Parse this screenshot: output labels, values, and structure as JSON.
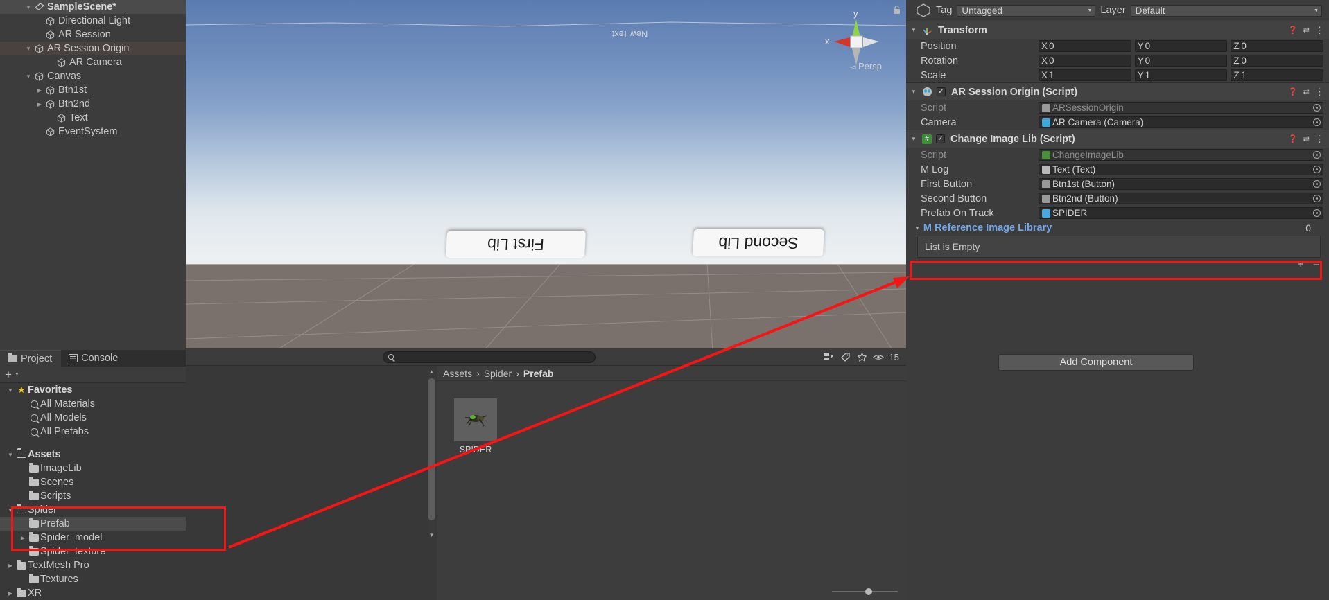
{
  "hierarchy": {
    "items": [
      {
        "label": "SampleScene*",
        "icon": "scene-icon",
        "depth": 2,
        "twisty": "down",
        "selected": false,
        "bold": true,
        "header": true
      },
      {
        "label": "Directional Light",
        "icon": "cube-icon",
        "depth": 3,
        "twisty": "",
        "selected": false
      },
      {
        "label": "AR Session",
        "icon": "cube-icon",
        "depth": 3,
        "twisty": "",
        "selected": false
      },
      {
        "label": "AR Session Origin",
        "icon": "cube-icon",
        "depth": 2,
        "twisty": "down",
        "selected": true
      },
      {
        "label": "AR Camera",
        "icon": "cube-icon",
        "depth": 4,
        "twisty": "",
        "selected": false
      },
      {
        "label": "Canvas",
        "icon": "cube-icon",
        "depth": 2,
        "twisty": "down",
        "selected": false
      },
      {
        "label": "Btn1st",
        "icon": "cube-icon",
        "depth": 3,
        "twisty": "right",
        "selected": false
      },
      {
        "label": "Btn2nd",
        "icon": "cube-icon",
        "depth": 3,
        "twisty": "right",
        "selected": false
      },
      {
        "label": "Text",
        "icon": "cube-icon",
        "depth": 4,
        "twisty": "",
        "selected": false
      },
      {
        "label": "EventSystem",
        "icon": "cube-icon",
        "depth": 3,
        "twisty": "",
        "selected": false
      }
    ]
  },
  "scene": {
    "new_text_label": "New Text",
    "plane_first": "First Lib",
    "plane_second": "Second Lib",
    "persp_label": "Persp",
    "gizmo_axis_y": "y",
    "gizmo_axis_x": "x"
  },
  "project": {
    "tabs": [
      {
        "label": "Project",
        "icon": "folder-icon",
        "active": true
      },
      {
        "label": "Console",
        "icon": "console-icon",
        "active": false
      }
    ],
    "tree": [
      {
        "label": "Favorites",
        "icon": "star-icon",
        "depth": 0,
        "twisty": "down",
        "bold": true,
        "selected": false
      },
      {
        "label": "All Materials",
        "icon": "search-icon",
        "depth": 1,
        "twisty": "",
        "bold": false,
        "selected": false
      },
      {
        "label": "All Models",
        "icon": "search-icon",
        "depth": 1,
        "twisty": "",
        "bold": false,
        "selected": false
      },
      {
        "label": "All Prefabs",
        "icon": "search-icon",
        "depth": 1,
        "twisty": "",
        "bold": false,
        "selected": false
      },
      {
        "label": "",
        "icon": "",
        "depth": 0,
        "twisty": "",
        "bold": false,
        "selected": false,
        "spacer": true
      },
      {
        "label": "Assets",
        "icon": "folder-open-icon",
        "depth": 0,
        "twisty": "down",
        "bold": true,
        "selected": false
      },
      {
        "label": "ImageLib",
        "icon": "folder-icon",
        "depth": 1,
        "twisty": "",
        "bold": false,
        "selected": false
      },
      {
        "label": "Scenes",
        "icon": "folder-icon",
        "depth": 1,
        "twisty": "",
        "bold": false,
        "selected": false
      },
      {
        "label": "Scripts",
        "icon": "folder-icon",
        "depth": 1,
        "twisty": "",
        "bold": false,
        "selected": false
      },
      {
        "label": "Spider",
        "icon": "folder-open-icon",
        "depth": 0,
        "twisty": "down",
        "bold": false,
        "selected": false
      },
      {
        "label": "Prefab",
        "icon": "folder-icon",
        "depth": 1,
        "twisty": "",
        "bold": false,
        "selected": true
      },
      {
        "label": "Spider_model",
        "icon": "folder-icon",
        "depth": 1,
        "twisty": "right",
        "bold": false,
        "selected": false
      },
      {
        "label": "Spider_texture",
        "icon": "folder-icon",
        "depth": 1,
        "twisty": "",
        "bold": false,
        "selected": false
      },
      {
        "label": "TextMesh Pro",
        "icon": "folder-icon",
        "depth": 0,
        "twisty": "right",
        "bold": false,
        "selected": false
      },
      {
        "label": "Textures",
        "icon": "folder-icon",
        "depth": 1,
        "twisty": "",
        "bold": false,
        "selected": false
      },
      {
        "label": "XR",
        "icon": "folder-icon",
        "depth": 0,
        "twisty": "right",
        "bold": false,
        "selected": false
      }
    ],
    "search_placeholder": "",
    "search_value": "",
    "item_count": "15",
    "breadcrumb": [
      "Assets",
      "Spider",
      "Prefab"
    ],
    "breadcrumb_separator": "›",
    "assets": [
      {
        "name": "SPIDER",
        "icon": "spider-prefab-thumbnail"
      }
    ]
  },
  "inspector": {
    "tag_label": "Tag",
    "tag_value": "Untagged",
    "layer_label": "Layer",
    "layer_value": "Default",
    "components": [
      {
        "title": "Transform",
        "icon": "transform-icon",
        "has_checkbox": false,
        "rows": [
          {
            "label": "Position",
            "type": "vector3",
            "x": "0",
            "y": "0",
            "z": "0"
          },
          {
            "label": "Rotation",
            "type": "vector3",
            "x": "0",
            "y": "0",
            "z": "0"
          },
          {
            "label": "Scale",
            "type": "vector3",
            "x": "1",
            "y": "1",
            "z": "1"
          }
        ]
      },
      {
        "title": "AR Session Origin (Script)",
        "icon": "script-ar-icon",
        "has_checkbox": true,
        "checked": true,
        "rows": [
          {
            "label": "Script",
            "type": "object",
            "value": "ARSessionOrigin",
            "dim": true,
            "icon": "ar-script-icon"
          },
          {
            "label": "Camera",
            "type": "object",
            "value": "AR Camera (Camera)",
            "dim": false,
            "icon": "camera-icon"
          }
        ]
      },
      {
        "title": "Change Image Lib (Script)",
        "icon": "csharp-script-icon",
        "has_checkbox": true,
        "checked": true,
        "rows": [
          {
            "label": "Script",
            "type": "object",
            "value": "ChangeImageLib",
            "dim": true,
            "icon": "csharp-script-icon"
          },
          {
            "label": "M Log",
            "type": "object",
            "value": "Text (Text)",
            "dim": false,
            "icon": "text-icon"
          },
          {
            "label": "First Button",
            "type": "object",
            "value": "Btn1st (Button)",
            "dim": false,
            "icon": "button-icon"
          },
          {
            "label": "Second Button",
            "type": "object",
            "value": "Btn2nd (Button)",
            "dim": false,
            "icon": "button-icon"
          },
          {
            "label": "Prefab On Track",
            "type": "object",
            "value": "SPIDER",
            "dim": false,
            "icon": "prefab-icon",
            "highlighted": true
          }
        ]
      }
    ],
    "list": {
      "title": "M Reference Image Library",
      "count": "0",
      "empty_text": "List is Empty",
      "add_symbol": "+",
      "remove_symbol": "–"
    },
    "add_component_label": "Add Component",
    "help_icon": "?",
    "preset_icon": "preset-icon",
    "menu_icon": "⋮"
  },
  "colors": {
    "highlight_red": "#f51515",
    "link_blue": "#6ea8e8",
    "selection_gray": "#4b4b4b"
  }
}
